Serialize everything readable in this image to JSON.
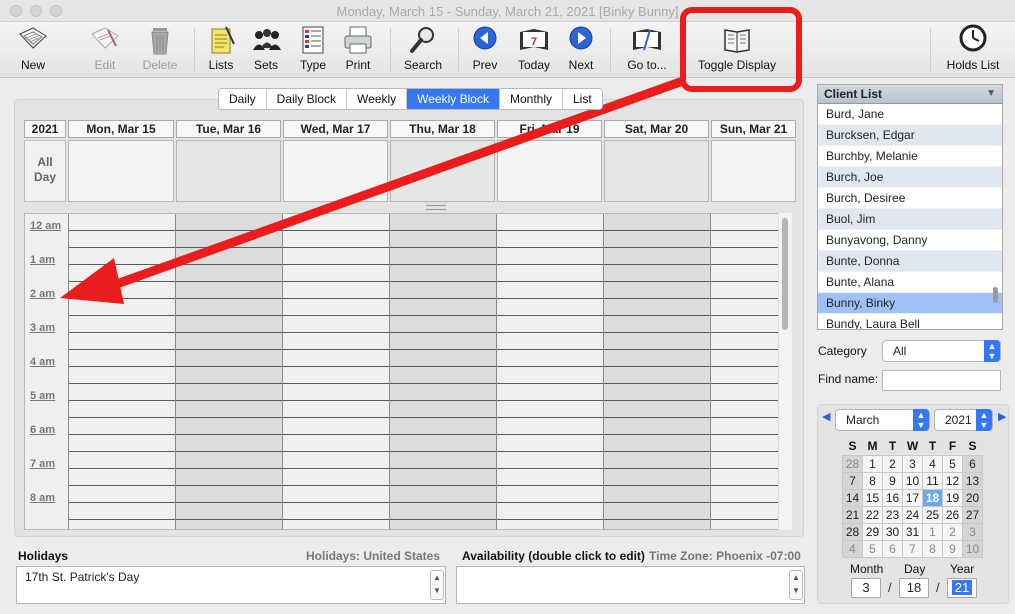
{
  "window": {
    "title": "Monday, March 15 - Sunday, March 21, 2021  [Binky Bunny]"
  },
  "toolbar": {
    "new": "New",
    "edit": "Edit",
    "delete": "Delete",
    "lists": "Lists",
    "sets": "Sets",
    "type": "Type",
    "print": "Print",
    "search": "Search",
    "prev": "Prev",
    "today": "Today",
    "next": "Next",
    "goto": "Go to...",
    "toggle_display": "Toggle Display",
    "holds_list": "Holds List"
  },
  "views": [
    "Daily",
    "Daily Block",
    "Weekly",
    "Weekly Block",
    "Monthly",
    "List"
  ],
  "active_view": "Weekly Block",
  "calendar": {
    "year": "2021",
    "days": [
      "Mon, Mar 15",
      "Tue, Mar 16",
      "Wed, Mar 17",
      "Thu, Mar 18",
      "Fri, Mar 19",
      "Sat, Mar 20",
      "Sun, Mar 21"
    ],
    "all_day_line1": "All",
    "all_day_line2": "Day",
    "hours": [
      "12 am",
      "1 am",
      "2 am",
      "3 am",
      "4 am",
      "5 am",
      "6 am",
      "7 am",
      "8 am"
    ]
  },
  "holidays": {
    "label": "Holidays",
    "region": "Holidays: United States",
    "entry": "17th St. Patrick's Day"
  },
  "availability": {
    "label": "Availability (double click to edit)",
    "timezone": "Time Zone: Phoenix -07:00"
  },
  "client_list": {
    "title": "Client List",
    "clients": [
      "Burd, Jane",
      "Burcksen, Edgar",
      "Burchby, Melanie",
      "Burch, Joe",
      "Burch, Desiree",
      "Buol, Jim",
      "Bunyavong, Danny",
      "Bunte, Donna",
      "Bunte, Alana",
      "Bunny, Binky",
      "Bundy, Laura Bell"
    ],
    "selected": "Bunny, Binky"
  },
  "filters": {
    "category_label": "Category",
    "category_value": "All",
    "find_label": "Find name:",
    "find_value": ""
  },
  "mini_calendar": {
    "month": "March",
    "year": "2021",
    "weekdays": [
      "S",
      "M",
      "T",
      "W",
      "T",
      "F",
      "S"
    ],
    "weeks": [
      [
        "28",
        "1",
        "2",
        "3",
        "4",
        "5",
        "6"
      ],
      [
        "7",
        "8",
        "9",
        "10",
        "11",
        "12",
        "13"
      ],
      [
        "14",
        "15",
        "16",
        "17",
        "18",
        "19",
        "20"
      ],
      [
        "21",
        "22",
        "23",
        "24",
        "25",
        "26",
        "27"
      ],
      [
        "28",
        "29",
        "30",
        "31",
        "1",
        "2",
        "3"
      ],
      [
        "4",
        "5",
        "6",
        "7",
        "8",
        "9",
        "10"
      ]
    ],
    "today": "18",
    "month_label": "Month",
    "day_label": "Day",
    "year_label": "Year",
    "month_value": "3",
    "day_value": "18",
    "year_value": "21"
  },
  "colors": {
    "accent": "#3478f6",
    "annotation": "#ea1c1c"
  }
}
